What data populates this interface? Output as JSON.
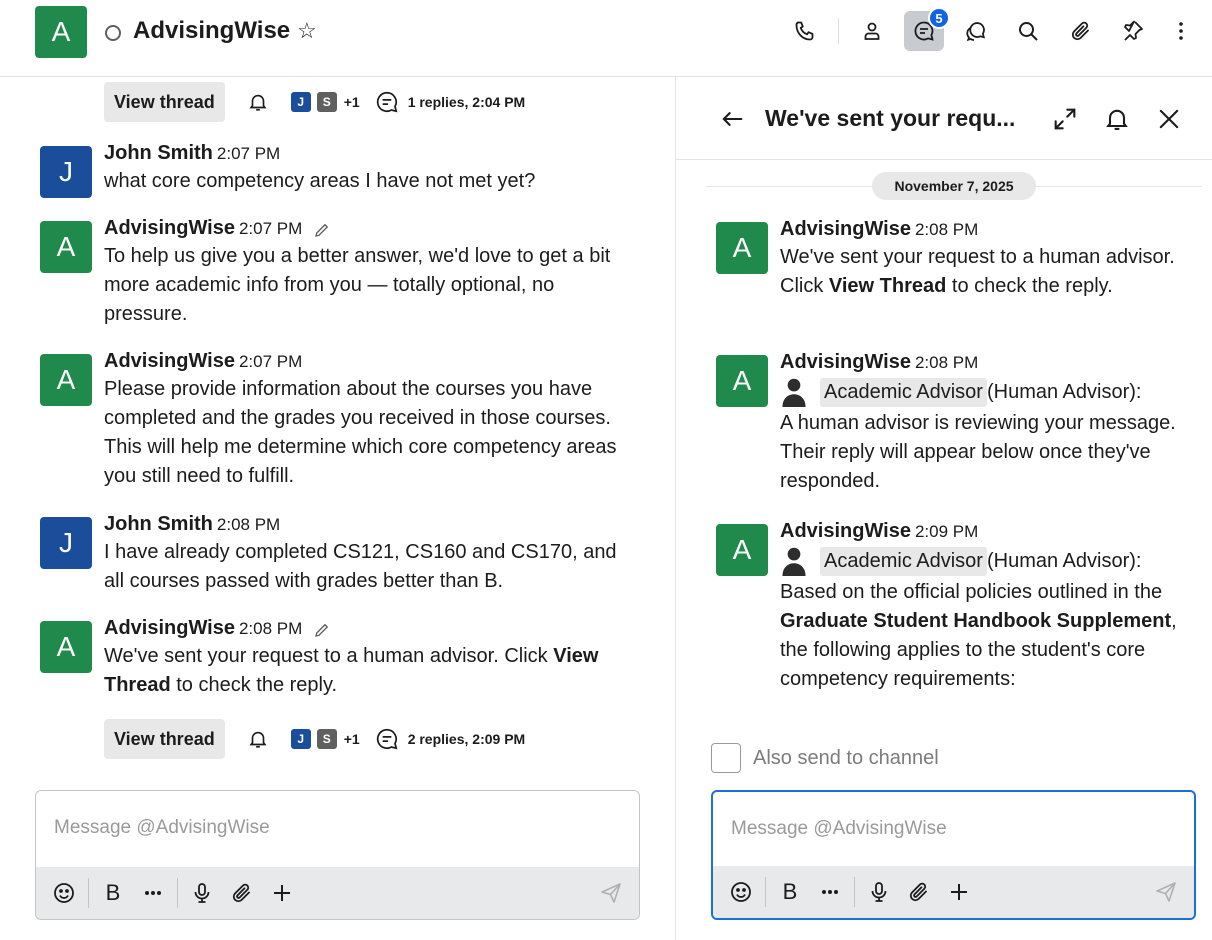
{
  "header": {
    "avatar_letter": "A",
    "channel_name": "AdvisingWise",
    "thread_badge": "5"
  },
  "thread_bar_1": {
    "button": "View thread",
    "user1": "J",
    "user2": "S",
    "more": "+1",
    "replies": "1 replies, 2:04 PM"
  },
  "thread_bar_2": {
    "button": "View thread",
    "user1": "J",
    "user2": "S",
    "more": "+1",
    "replies": "2 replies, 2:09 PM"
  },
  "messages": [
    {
      "avatar": "J",
      "author": "John Smith",
      "time": "2:07 PM",
      "text": "what core competency areas I have not met yet?"
    },
    {
      "avatar": "A",
      "author": "AdvisingWise",
      "time": "2:07 PM",
      "text": "To help us give you a better answer, we'd love to get a bit more academic info from you — totally optional, no pressure."
    },
    {
      "avatar": "A",
      "author": "AdvisingWise",
      "time": "2:07 PM",
      "text": "Please provide information about the courses you have completed and the grades you received in those courses. This will help me determine which core competency areas you still need to fulfill."
    },
    {
      "avatar": "J",
      "author": "John Smith",
      "time": "2:08 PM",
      "text": "I have already completed CS121, CS160 and CS170, and all courses passed with grades better than B."
    },
    {
      "avatar": "A",
      "author": "AdvisingWise",
      "time": "2:08 PM",
      "text_before": "We've sent your request to a human advisor. Click ",
      "text_bold": "View Thread",
      "text_after": " to check the reply."
    }
  ],
  "composer_main": {
    "placeholder": "Message @AdvisingWise",
    "bold": "B"
  },
  "thread": {
    "title": "We've sent your requ...",
    "date": "November 7, 2025",
    "messages": [
      {
        "avatar": "A",
        "author": "AdvisingWise",
        "time": "2:08 PM",
        "text_before": "We've sent your request to a human advisor. Click ",
        "text_bold": "View Thread",
        "text_after": " to check the reply."
      },
      {
        "avatar": "A",
        "author": "AdvisingWise",
        "time": "2:08 PM",
        "advisor_tag": "Academic Advisor",
        "advisor_suffix": " (Human Advisor):",
        "text": "A human advisor is reviewing your message. Their reply will appear below once they've responded."
      },
      {
        "avatar": "A",
        "author": "AdvisingWise",
        "time": "2:09 PM",
        "advisor_tag": "Academic Advisor",
        "advisor_suffix": " (Human Advisor):",
        "text_before": "Based on the official policies outlined in the ",
        "text_bold": "Graduate Student Handbook Supplement",
        "text_after": ", the following applies to the student's core competency requirements:"
      }
    ],
    "also_send": "Also send to channel"
  },
  "composer_thread": {
    "placeholder": "Message @AdvisingWise",
    "bold": "B"
  }
}
